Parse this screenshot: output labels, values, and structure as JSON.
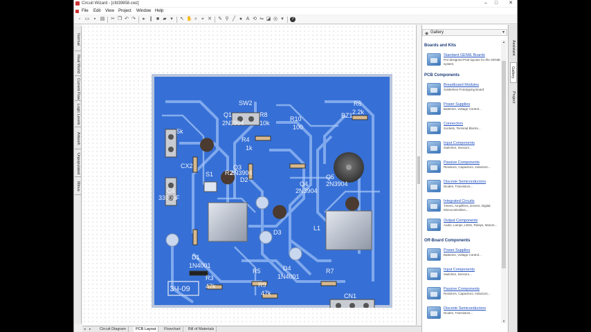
{
  "window": {
    "title": "Circuit Wizard - [cfd39858.cwz]",
    "controls": [
      "–",
      "□",
      "✕"
    ]
  },
  "menu": [
    "File",
    "Edit",
    "View",
    "Project",
    "Window",
    "Help"
  ],
  "left_tabs": [
    "Normal",
    "Real World",
    "Current Flow",
    "Logic Levels",
    "Artwork",
    "Unpopulated",
    "Minus"
  ],
  "bottom_tabs": [
    {
      "label": "Circuit Diagram",
      "active": false
    },
    {
      "label": "PCB Layout",
      "active": true
    },
    {
      "label": "Flowchart",
      "active": false
    },
    {
      "label": "Bill of Materials",
      "active": false
    }
  ],
  "gallery": {
    "header": "Gallery",
    "sections": [
      {
        "title": "Boards and Kits",
        "items": [
          {
            "name": "Standard GENIE Boards",
            "desc": "Pre-designed PCB layouts for the GENIE system.",
            "icon": "board-icon"
          }
        ]
      },
      {
        "title": "PCB Components",
        "items": [
          {
            "name": "Breadboard Modules",
            "desc": "Solderless Prototyping Board",
            "icon": "folder-icon"
          },
          {
            "name": "Power Supplies",
            "desc": "Batteries, Voltage Control...",
            "icon": "folder-icon"
          },
          {
            "name": "Connectors",
            "desc": "Sockets, Terminal Blocks...",
            "icon": "folder-icon"
          },
          {
            "name": "Input Components",
            "desc": "Switches, Sensors...",
            "icon": "folder-icon"
          },
          {
            "name": "Passive Components",
            "desc": "Resistors, Capacitors, Inductors...",
            "icon": "folder-icon"
          },
          {
            "name": "Discrete Semiconductors",
            "desc": "Diodes, Transistors...",
            "icon": "folder-icon"
          },
          {
            "name": "Integrated Circuits",
            "desc": "Timers, Amplifiers, Drivers, Digital, Microcontrollers...",
            "icon": "folder-icon"
          },
          {
            "name": "Output Components",
            "desc": "Audio, Lamps, LEDs, Relays, Motors...",
            "icon": "folder-icon"
          }
        ]
      },
      {
        "title": "Off-Board Components",
        "items": [
          {
            "name": "Power Supplies",
            "desc": "Batteries, Voltage Control...",
            "icon": "folder-icon"
          },
          {
            "name": "Input Components",
            "desc": "Switches, Sensors...",
            "icon": "folder-icon"
          },
          {
            "name": "Passive Components",
            "desc": "Resistors, Capacitors, Inductors...",
            "icon": "folder-icon"
          },
          {
            "name": "Discrete Semiconductors",
            "desc": "Diodes, Transistors...",
            "icon": "folder-icon"
          }
        ]
      }
    ]
  },
  "right_tabs": [
    {
      "label": "Assistant",
      "active": false
    },
    {
      "label": "Gallery",
      "active": true
    },
    {
      "label": "Project",
      "active": false
    }
  ],
  "pcb": {
    "board_color": "#3670d6",
    "labels": [
      {
        "text": "SW2"
      },
      {
        "text": "R6"
      },
      {
        "text": "2.2k"
      },
      {
        "text": "Q1"
      },
      {
        "text": "2N3904"
      },
      {
        "text": "R8"
      },
      {
        "text": "10k"
      },
      {
        "text": "R10"
      },
      {
        "text": "100"
      },
      {
        "text": "BZ1"
      },
      {
        "text": "R4"
      },
      {
        "text": "1k"
      },
      {
        "text": "5k"
      },
      {
        "text": "CX2"
      },
      {
        "text": "S1"
      },
      {
        "text": "R2"
      },
      {
        "text": "2N3904"
      },
      {
        "text": "D2"
      },
      {
        "text": "Q3"
      },
      {
        "text": "Q4"
      },
      {
        "text": "2N3904"
      },
      {
        "text": "Q5"
      },
      {
        "text": "2N3904"
      },
      {
        "text": "C4"
      },
      {
        "text": "3300uF"
      },
      {
        "text": "D3"
      },
      {
        "text": "L1"
      },
      {
        "text": "D1"
      },
      {
        "text": "1N4001"
      },
      {
        "text": "R3"
      },
      {
        "text": "47k"
      },
      {
        "text": "R5"
      },
      {
        "text": "D4"
      },
      {
        "text": "1N4001"
      },
      {
        "text": "R9"
      },
      {
        "text": "47k"
      },
      {
        "text": "R7"
      },
      {
        "text": "CN1"
      },
      {
        "text": "ЗЧ-09"
      }
    ]
  }
}
